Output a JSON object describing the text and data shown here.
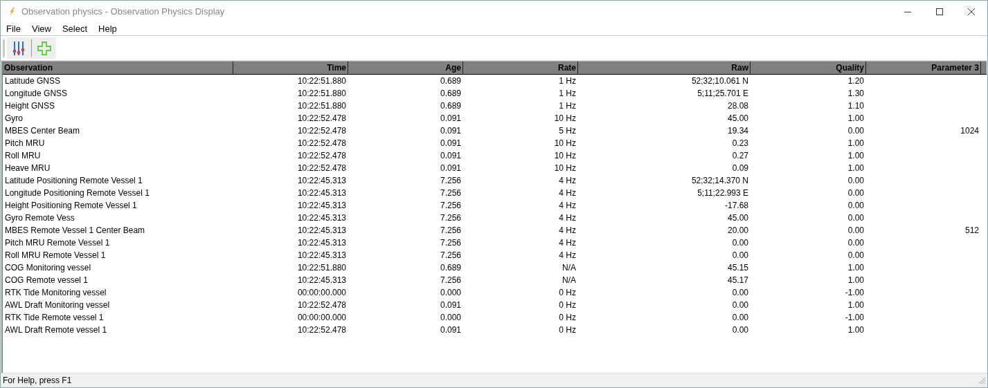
{
  "window": {
    "title": "Observation physics - Observation Physics Display"
  },
  "menu": [
    "File",
    "View",
    "Select",
    "Help"
  ],
  "table": {
    "columns": [
      "Observation",
      "Time",
      "Age",
      "Rate",
      "Raw",
      "Quality",
      "Parameter 3"
    ],
    "rows": [
      [
        "Latitude GNSS",
        "10:22:51.880",
        "0.689",
        "1 Hz",
        "52;32;10.061 N",
        "1.20"
      ],
      [
        "Longitude GNSS",
        "10:22:51.880",
        "0.689",
        "1 Hz",
        "5;11;25.701 E",
        "1.30"
      ],
      [
        "Height GNSS",
        "10:22:51.880",
        "0.689",
        "1 Hz",
        "28.08",
        "1.10"
      ],
      [
        "Gyro",
        "10:22:52.478",
        "0.091",
        "10 Hz",
        "45.00",
        "1.00"
      ],
      [
        "MBES Center Beam",
        "10:22:52.478",
        "0.091",
        "5 Hz",
        "19.34",
        "0.00",
        "1024"
      ],
      [
        "Pitch MRU",
        "10:22:52.478",
        "0.091",
        "10 Hz",
        "0.23",
        "1.00"
      ],
      [
        "Roll MRU",
        "10:22:52.478",
        "0.091",
        "10 Hz",
        "0.27",
        "1.00"
      ],
      [
        "Heave MRU",
        "10:22:52.478",
        "0.091",
        "10 Hz",
        "0.09",
        "1.00"
      ],
      [
        "Latitude Positioning Remote Vessel 1",
        "10:22:45.313",
        "7.256",
        "4 Hz",
        "52;32;14.370 N",
        "0.00"
      ],
      [
        "Longitude Positioning Remote Vessel 1",
        "10:22:45.313",
        "7.256",
        "4 Hz",
        "5;11;22.993 E",
        "0.00"
      ],
      [
        "Height Positioning Remote Vessel 1",
        "10:22:45.313",
        "7.256",
        "4 Hz",
        "-17.68",
        "0.00"
      ],
      [
        "Gyro Remote Vess",
        "10:22:45.313",
        "7.256",
        "4 Hz",
        "45.00",
        "0.00"
      ],
      [
        "MBES Remote Vessel 1 Center Beam",
        "10:22:45.313",
        "7.256",
        "4 Hz",
        "20.00",
        "0.00",
        "512"
      ],
      [
        "Pitch MRU Remote Vessel 1",
        "10:22:45.313",
        "7.256",
        "4 Hz",
        "0.00",
        "0.00"
      ],
      [
        "Roll MRU Remote Vessel 1",
        "10:22:45.313",
        "7.256",
        "4 Hz",
        "0.00",
        "0.00"
      ],
      [
        "COG Monitoring vessel",
        "10:22:51.880",
        "0.689",
        "N/A",
        "45.15",
        "1.00"
      ],
      [
        "COG Remote vessel 1",
        "10:22:45.313",
        "7.256",
        "N/A",
        "45.17",
        "1.00"
      ],
      [
        "RTK Tide Monitoring vessel",
        "00:00:00.000",
        "0.000",
        "0 Hz",
        "0.00",
        "-1.00"
      ],
      [
        "AWL Draft Monitoring vessel",
        "10:22:52.478",
        "0.091",
        "0 Hz",
        "0.00",
        "1.00"
      ],
      [
        "RTK Tide Remote vessel 1",
        "00:00:00.000",
        "0.000",
        "0 Hz",
        "0.00",
        "-1.00"
      ],
      [
        "AWL Draft Remote vessel 1",
        "10:22:52.478",
        "0.091",
        "0 Hz",
        "0.00",
        "1.00"
      ]
    ]
  },
  "status_bar": "For Help, press F1"
}
